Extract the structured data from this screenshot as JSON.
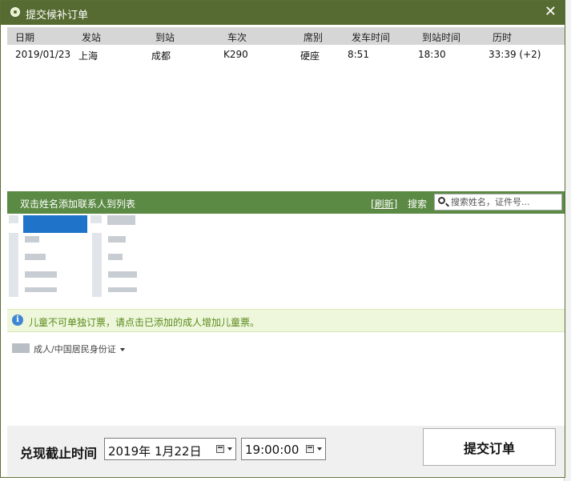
{
  "window": {
    "title": "提交候补订单",
    "close_symbol": "✕"
  },
  "train_table": {
    "headers": [
      "日期",
      "发站",
      "到站",
      "车次",
      "席别",
      "发车时间",
      "到站时间",
      "历时"
    ],
    "rows": [
      [
        "2019/01/23",
        "上海",
        "成都",
        "K290",
        "硬座",
        "8:51",
        "18:30",
        "33:39 (+2)"
      ]
    ]
  },
  "passenger_bar": {
    "label": "双击姓名添加联系人到列表",
    "refresh": "[刷新]",
    "search_label": "搜索",
    "search_placeholder": "搜索姓名，证件号..."
  },
  "notice": {
    "icon": "info-icon",
    "icon_glyph": "i",
    "text": "儿童不可单独订票，请点击已添加的成人增加儿童票。"
  },
  "passenger": {
    "type_label": "成人/中国居民身份证"
  },
  "footer": {
    "deadline_label": "兑现截止时间",
    "date_value": "2019年  1月22日",
    "time_value": "19:00:00",
    "submit_label": "提交订单"
  },
  "colors": {
    "titlebar": "#566b31",
    "passenger_bar": "#5b8a44",
    "notice_bg": "#eef7dc",
    "notice_text": "#5a8a1a",
    "selection": "#1f73c9"
  }
}
